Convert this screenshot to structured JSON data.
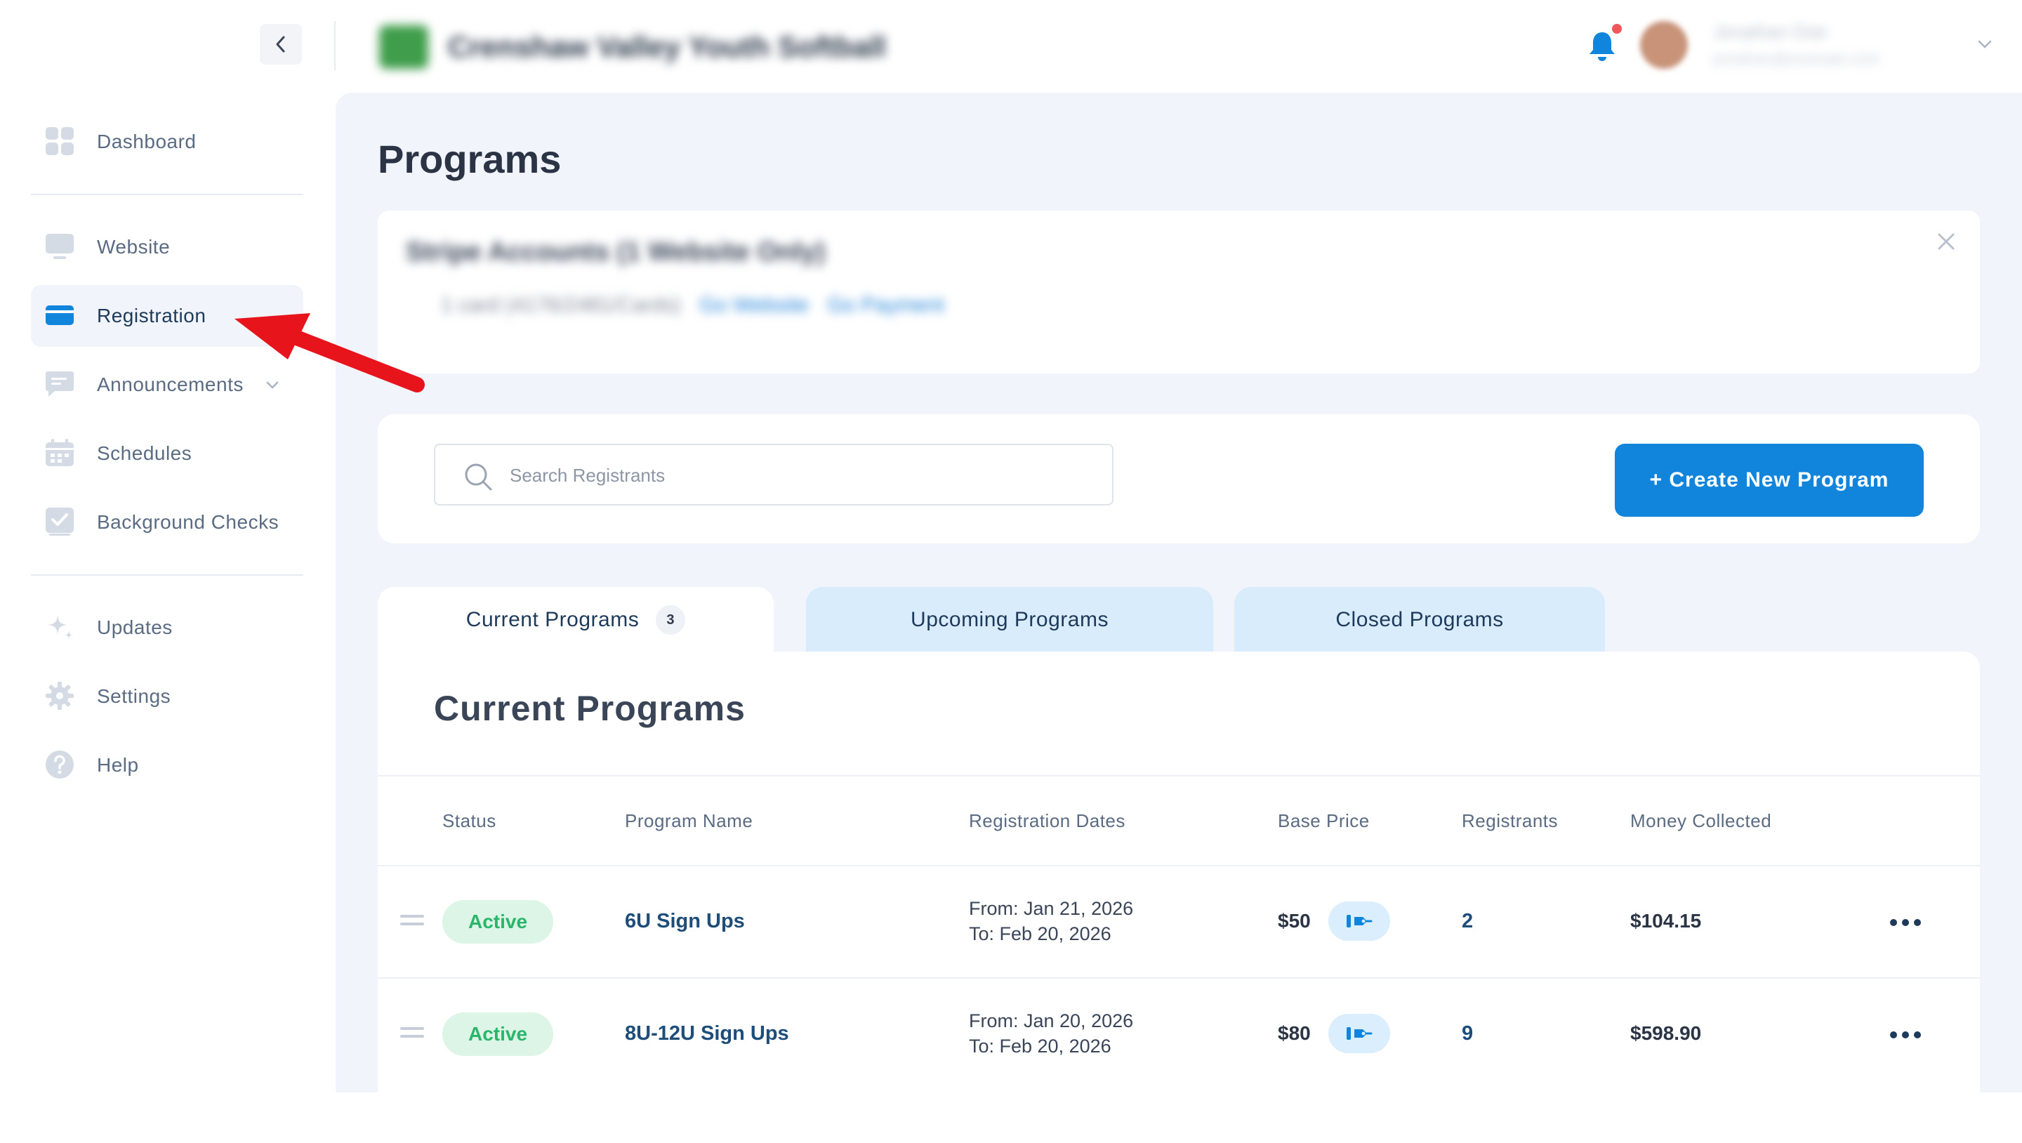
{
  "header": {
    "club_name": "Crenshaw Valley Youth Softball",
    "user_name": "Jonathan Doe",
    "user_email": "jonathan@example.com"
  },
  "sidebar": {
    "items": [
      {
        "label": "Dashboard",
        "icon": "dashboard-icon"
      },
      {
        "label": "Website",
        "icon": "monitor-icon"
      },
      {
        "label": "Registration",
        "icon": "card-icon",
        "active": true
      },
      {
        "label": "Announcements",
        "icon": "chat-icon"
      },
      {
        "label": "Schedules",
        "icon": "calendar-icon"
      },
      {
        "label": "Background Checks",
        "icon": "check-icon"
      },
      {
        "label": "Updates",
        "icon": "sparkle-icon"
      },
      {
        "label": "Settings",
        "icon": "gear-icon"
      },
      {
        "label": "Help",
        "icon": "help-icon"
      }
    ]
  },
  "page": {
    "title": "Programs"
  },
  "banner": {
    "title": "Stripe Accounts (1 Website Only)",
    "detail": "1 card (4176/2481/Cards)",
    "link1": "Go Website",
    "link2": "Go Payment"
  },
  "search": {
    "placeholder": "Search Registrants"
  },
  "create_button": "+ Create New Program",
  "tabs": [
    {
      "label": "Current Programs",
      "count": "3"
    },
    {
      "label": "Upcoming Programs"
    },
    {
      "label": "Closed Programs"
    }
  ],
  "section_title": "Current Programs",
  "table": {
    "headers": [
      "Status",
      "Program Name",
      "Registration Dates",
      "Base Price",
      "Registrants",
      "Money Collected"
    ],
    "rows": [
      {
        "status": "Active",
        "name": "6U Sign Ups",
        "from": "From: Jan 21, 2026",
        "to": "To: Feb 20, 2026",
        "price": "$50",
        "registrants": "2",
        "money": "$104.15"
      },
      {
        "status": "Active",
        "name": "8U-12U Sign Ups",
        "from": "From: Jan 20, 2026",
        "to": "To: Feb 20, 2026",
        "price": "$80",
        "registrants": "9",
        "money": "$598.90"
      }
    ]
  },
  "colors": {
    "accent": "#1185dc",
    "active_status_bg": "#dcf5e6",
    "active_status_text": "#29b56a",
    "annotation_arrow": "#e8141b"
  }
}
